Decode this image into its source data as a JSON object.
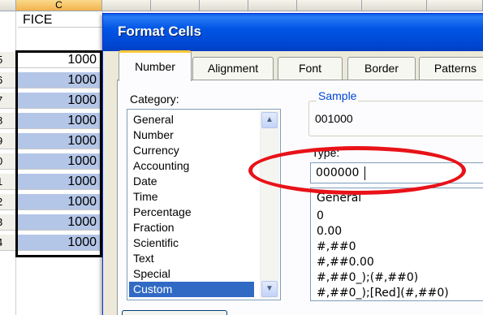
{
  "spreadsheet": {
    "column_headers": [
      "",
      "C",
      "",
      "",
      "",
      "",
      "",
      "",
      ""
    ],
    "header_cell": "FICE",
    "row_numbers": [
      "5",
      "6",
      "7",
      "8",
      "9",
      "0",
      "1",
      "2",
      "3",
      "4"
    ],
    "values": [
      "1000",
      "1000",
      "1000",
      "1000",
      "1000",
      "1000",
      "1000",
      "1000",
      "1000",
      "1000"
    ]
  },
  "dialog": {
    "title": "Format Cells",
    "tabs": [
      "Number",
      "Alignment",
      "Font",
      "Border",
      "Patterns"
    ],
    "active_tab": "Number",
    "category_label": "Category:",
    "categories": [
      "General",
      "Number",
      "Currency",
      "Accounting",
      "Date",
      "Time",
      "Percentage",
      "Fraction",
      "Scientific",
      "Text",
      "Special",
      "Custom"
    ],
    "selected_category": "Custom",
    "sample_label": "Sample",
    "sample_value": "001000",
    "type_label": "Type:",
    "type_value": "000000",
    "format_codes": [
      "General",
      "0",
      "0.00",
      "#,##0",
      "#,##0.00",
      "#,##0_);(#,##0)",
      "#,##0_);[Red](#,##0)"
    ],
    "icons": {
      "scroll_up": "scroll-up-arrow-icon",
      "scroll_down": "scroll-down-arrow-icon"
    },
    "colors": {
      "title_bar": "#0055e5",
      "selection": "#316ac5",
      "highlight_cells": "#b4c6e7",
      "annotation": "#e81218",
      "active_tab_accent": "#ffc83c"
    }
  }
}
